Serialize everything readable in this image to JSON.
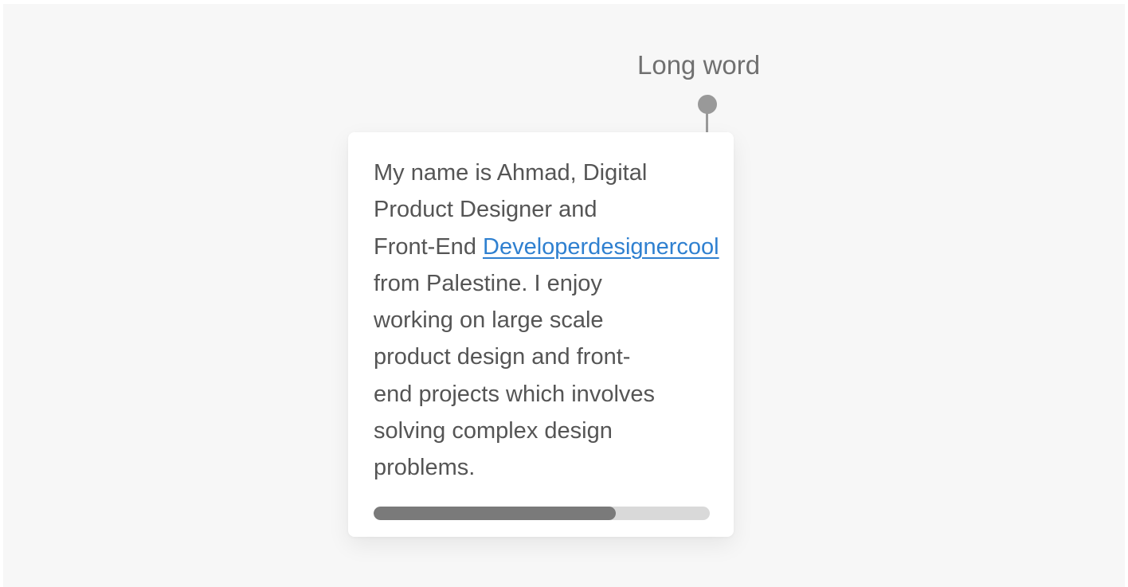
{
  "annotation": {
    "label": "Long word"
  },
  "card": {
    "lines": [
      "My name is Ahmad, Digital",
      "Product Designer and",
      "Front-End "
    ],
    "link_text": "Developerdesignercool",
    "lines_after": [
      "from Palestine. I enjoy",
      "working on large scale",
      "product design and front-",
      "end projects which involves",
      "solving complex design",
      "problems."
    ],
    "progress": 0.72
  },
  "colors": {
    "link": "#2f80d0",
    "progress_fill": "#7a7a7a",
    "progress_track": "#d9d9d9",
    "annotation": "#999999"
  }
}
